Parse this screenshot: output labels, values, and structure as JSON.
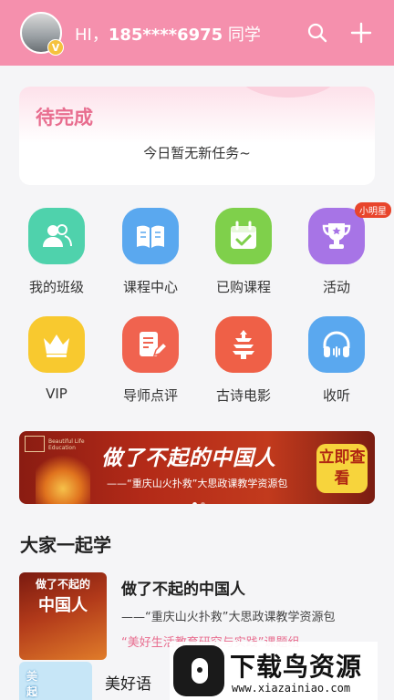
{
  "header": {
    "greeting_prefix": "HI，",
    "phone": "185****6975",
    "greeting_suffix": " 同学",
    "avatar_badge": "V",
    "bg_color": "#f590ad"
  },
  "todo": {
    "title": "待完成",
    "empty_text": "今日暂无新任务~"
  },
  "grid": [
    {
      "label": "我的班级",
      "icon": "class-icon",
      "color": "#4fd2ac"
    },
    {
      "label": "课程中心",
      "icon": "book-icon",
      "color": "#5aa8ef"
    },
    {
      "label": "已购课程",
      "icon": "calendar-check-icon",
      "color": "#7fd04b"
    },
    {
      "label": "活动",
      "icon": "trophy-icon",
      "color": "#a774e6",
      "badge": "小明星"
    },
    {
      "label": "VIP",
      "icon": "crown-icon",
      "color": "#f8c92f"
    },
    {
      "label": "导师点评",
      "icon": "edit-note-icon",
      "color": "#f0634f"
    },
    {
      "label": "古诗电影",
      "icon": "pagoda-icon",
      "color": "#ef6047"
    },
    {
      "label": "收听",
      "icon": "headphones-icon",
      "color": "#5aa8ef"
    }
  ],
  "banner": {
    "title": "做了不起的中国人",
    "subtitle": "——“重庆山火扑救”大思政课教学资源包",
    "button": "立即查看",
    "logo_text": "Beautiful Life Education"
  },
  "section": {
    "title": "大家一起学"
  },
  "courses": [
    {
      "thumb_line1": "做了不起的",
      "thumb_line2": "中国人",
      "title": "做了不起的中国人",
      "subtitle": "——“重庆山火扑救”大思政课教学资源包",
      "tag": "“美好生活教育研究与实践”课题组"
    },
    {
      "thumb_line1": "美好语文",
      "thumb_line2": "一起学",
      "title": "美好语"
    }
  ],
  "watermark": {
    "name": "下载鸟资源",
    "url": "www.xiazainiao.com"
  }
}
